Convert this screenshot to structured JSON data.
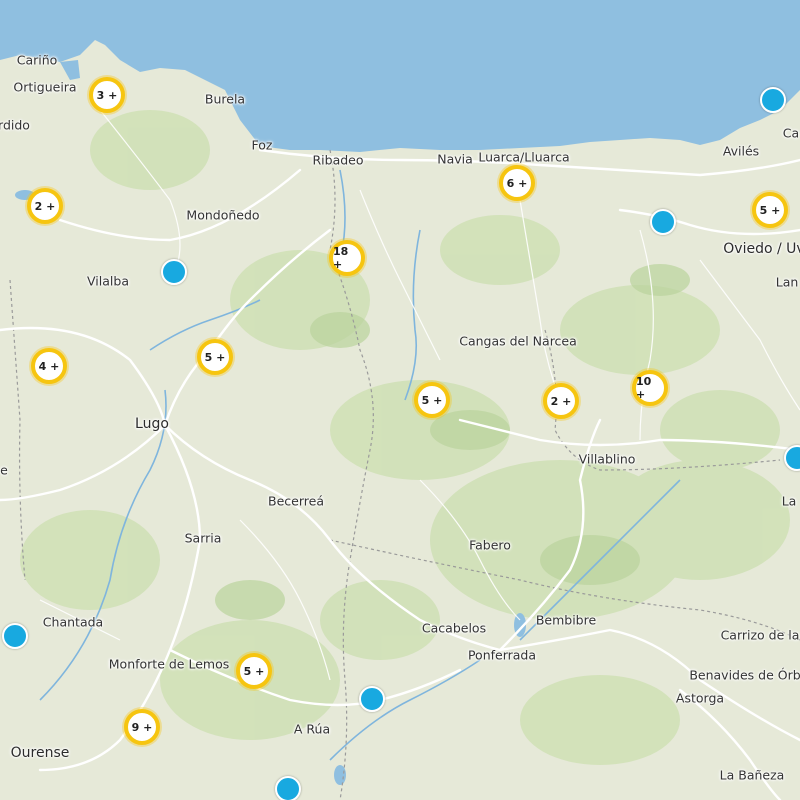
{
  "colors": {
    "sea": "#8fbfe0",
    "land": "#e6e9d8",
    "forest": "#cfe0b5",
    "road": "#ffffff",
    "border": "#9a9a9a",
    "cluster_ring": "#f6c510",
    "marker": "#18a9e0"
  },
  "places": {
    "carino": "Cariño",
    "ortigueira": "Ortigueira",
    "viveiro_partial": "rdido",
    "burela": "Burela",
    "foz": "Foz",
    "ribadeo": "Ribadeo",
    "navia": "Navia",
    "luarca": "Luarca/Lluarca",
    "aviles": "Avilés",
    "cangas_edge": "Ca",
    "mondonedo": "Mondoñedo",
    "oviedo": "Oviedo / Uv",
    "langreo_partial": "Lan",
    "vilalba": "Vilalba",
    "cangas_narcea": "Cangas del Narcea",
    "lugo": "Lugo",
    "left_edge_e": "e",
    "villablino": "Villablino",
    "la_partial": "La",
    "becerrea": "Becerreá",
    "sarria": "Sarria",
    "fabero": "Fabero",
    "chantada": "Chantada",
    "cacabelos": "Cacabelos",
    "bembibre": "Bembibre",
    "carrizo": "Carrizo de la",
    "ponferrada": "Ponferrada",
    "monforte": "Monforte de Lemos",
    "benavides": "Benavides de Órb",
    "astorga": "Astorga",
    "a_rua": "A Rúa",
    "ourense": "Ourense",
    "la_baneza": "La Bañeza"
  },
  "clusters": [
    {
      "id": "ortigueira",
      "label": "3 +"
    },
    {
      "id": "west",
      "label": "2 +"
    },
    {
      "id": "luarca",
      "label": "6 +"
    },
    {
      "id": "oviedo",
      "label": "5 +"
    },
    {
      "id": "ribadeo",
      "label": "18 +"
    },
    {
      "id": "vilalba-south",
      "label": "4 +"
    },
    {
      "id": "lugo-north",
      "label": "5 +"
    },
    {
      "id": "cangas-south",
      "label": "5 +"
    },
    {
      "id": "narcea",
      "label": "2 +"
    },
    {
      "id": "east",
      "label": "10 +"
    },
    {
      "id": "monforte",
      "label": "5 +"
    },
    {
      "id": "ourense",
      "label": "9 +"
    }
  ]
}
